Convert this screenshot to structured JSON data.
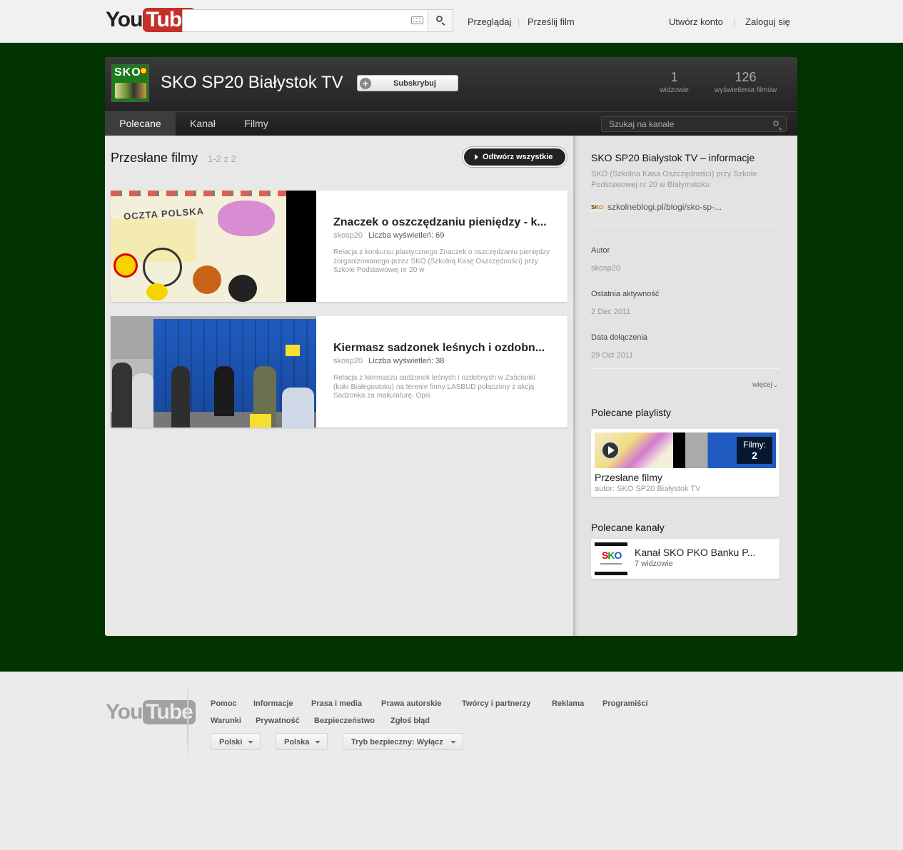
{
  "masthead": {
    "logo_you": "You",
    "logo_tube": "Tube",
    "search_value": "",
    "browse": "Przeglądaj",
    "upload": "Prześlij film",
    "create_account": "Utwórz konto",
    "sign_in": "Zaloguj się"
  },
  "channel": {
    "avatar_text": "SKO",
    "title": "SKO SP20 Białystok TV",
    "subscribe": "Subskrybuj",
    "stats": [
      {
        "value": "1",
        "label": "widzowie"
      },
      {
        "value": "126",
        "label": "wyświetlenia filmów"
      }
    ],
    "tabs": [
      "Polecane",
      "Kanał",
      "Filmy"
    ],
    "active_tab": "Polecane",
    "search_placeholder": "Szukaj na kanale"
  },
  "main": {
    "section_title": "Przesłane filmy",
    "section_count": "1-2 z 2",
    "play_all": "Odtwórz wszystkie",
    "videos": [
      {
        "title": "Znaczek o oszczędzaniu pieniędzy - k...",
        "author": "skosp20",
        "views": "Liczba wyświetleń: 69",
        "description": "Relacja z konkursu plastycznego Znaczek o oszczędzaniu pieniędzy zorganizowanego przez SKO (Szkolną Kasę Oszczędności) przy Szkole Podstawowej nr 20 w",
        "thumb_text": "OCZTA POLSKA"
      },
      {
        "title": "Kiermasz sadzonek leśnych i ozdobn...",
        "author": "skosp20",
        "views": "Liczba wyświetleń: 38",
        "description": "Relacja z kiermaszu sadzonek leśnych i ozdobnych w Zaścianki (koło Białegostoku) na terenie firmy LASBUD połączony z akcją Sadzonka za makulaturę. Opis"
      }
    ]
  },
  "sidebar": {
    "about_title": "SKO SP20 Białystok TV – informacje",
    "about_desc": "SKO (Szkolna Kasa Oszczędności) przy Szkole Podstawowej nr 20 w Białymstoku",
    "website_favicon": "SKO",
    "website": "szkolneblogi.pl/blogi/sko-sp-...",
    "props": [
      {
        "label": "Autor",
        "value": "skosp20"
      },
      {
        "label": "Ostatnia aktywność",
        "value": "2 Dec 2011"
      },
      {
        "label": "Data dołączenia",
        "value": "29 Oct 2011"
      }
    ],
    "more": "więcej",
    "playlists_title": "Polecane playlisty",
    "playlist": {
      "count_label": "Filmy:",
      "count": "2",
      "name": "Przesłane filmy",
      "author": "autor: SKO SP20 Białystok TV"
    },
    "channels_title": "Polecane kanały",
    "featured_channel": {
      "avatar_text": "SKO",
      "name": "Kanał SKO PKO Banku P...",
      "subscribers": "7 widzowie"
    }
  },
  "footer": {
    "links_row1": [
      "Pomoc",
      "Informacje",
      "Prasa i media",
      "Prawa autorskie",
      "Twórcy i partnerzy",
      "Reklama",
      "Programiści"
    ],
    "links_row2": [
      "Warunki",
      "Prywatność",
      "Bezpieczeństwo",
      "Zgłoś błąd"
    ],
    "language": "Polski",
    "country": "Polska",
    "safety": "Tryb bezpieczny: Wyłącz"
  },
  "colors": {
    "channel_background": "#003300",
    "youtube_red": "#c4302b"
  }
}
